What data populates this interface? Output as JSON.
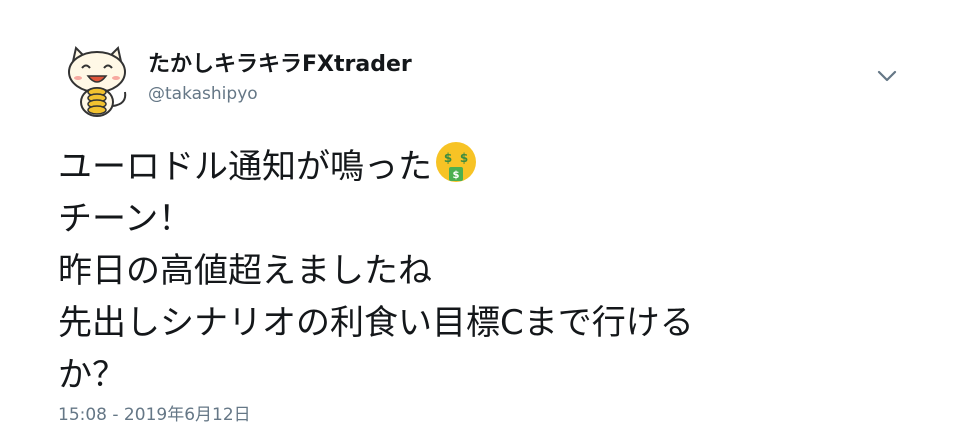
{
  "user": {
    "display_name": "たかしキラキラFXtrader",
    "handle": "@takashipyo",
    "avatar_icon": "cat-holding-coins-avatar-icon"
  },
  "menu": {
    "icon": "chevron-down-icon"
  },
  "tweet": {
    "lines": [
      "ユーロドル通知が鳴った",
      "チーン！",
      "昨日の高値超えましたね",
      "先出しシナリオの利食い目標Cまで行ける",
      "か？"
    ],
    "emoji": "money-mouth-face-icon",
    "timestamp": "15:08 - 2019年6月12日"
  },
  "colors": {
    "text": "#14171a",
    "secondary": "#657786",
    "emoji_face": "#f7c325",
    "emoji_money": "#3d8c40"
  }
}
